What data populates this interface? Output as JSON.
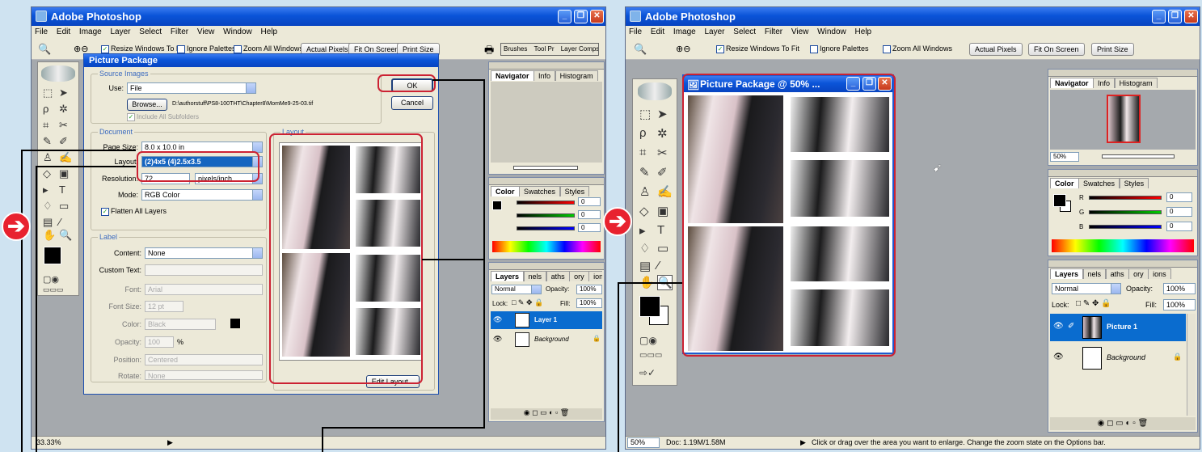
{
  "left": {
    "app_title": "Adobe Photoshop",
    "menu": [
      "File",
      "Edit",
      "Image",
      "Layer",
      "Select",
      "Filter",
      "View",
      "Window",
      "Help"
    ],
    "options": {
      "resize_windows": "Resize Windows To Fit",
      "ignore_palettes": "Ignore Palettes",
      "zoom_all": "Zoom All Windows",
      "actual_pixels": "Actual Pixels",
      "fit_on_screen": "Fit On Screen",
      "print_size": "Print Size",
      "well_tabs": [
        "Brushes",
        "Tool Pr",
        "Layer Comps"
      ]
    },
    "dialog": {
      "title": "Picture Package",
      "source_group": "Source Images",
      "use_label": "Use:",
      "use_value": "File",
      "browse_label": "Browse...",
      "file_path": "D:\\authorstuff\\PS8-100THT\\Chapter8\\MomMe9-25-03.tif",
      "include_subfolders": "Include All Subfolders",
      "document_group": "Document",
      "page_size_label": "Page Size:",
      "page_size_value": "8.0 x 10.0 in",
      "layout_label": "Layout:",
      "layout_value": "(2)4x5 (4)2.5x3.5",
      "resolution_label": "Resolution:",
      "resolution_value": "72",
      "resolution_unit": "pixels/inch",
      "mode_label": "Mode:",
      "mode_value": "RGB Color",
      "flatten_label": "Flatten All Layers",
      "label_group": "Label",
      "content_label": "Content:",
      "content_value": "None",
      "custom_text_label": "Custom Text:",
      "font_label": "Font:",
      "font_value": "Arial",
      "font_size_label": "Font Size:",
      "font_size_value": "12 pt",
      "color_label": "Color:",
      "color_value": "Black",
      "opacity_label": "Opacity:",
      "opacity_value": "100",
      "opacity_unit": "%",
      "position_label": "Position:",
      "position_value": "Centered",
      "rotate_label": "Rotate:",
      "rotate_value": "None",
      "layout_group": "Layout",
      "ok_label": "OK",
      "cancel_label": "Cancel",
      "edit_layout_label": "Edit Layout..."
    },
    "navigator_tabs": [
      "Navigator",
      "Info",
      "Histogram"
    ],
    "color_tabs": [
      "Color",
      "Swatches",
      "Styles"
    ],
    "color_values": {
      "r": "0",
      "g": "0",
      "b": "0"
    },
    "layers_tabs": [
      "Layers",
      "nels",
      "aths",
      "ory",
      "ions"
    ],
    "blend_mode": "Normal",
    "opacity_label": "Opacity:",
    "opacity_value": "100%",
    "lock_label": "Lock:",
    "fill_label": "Fill:",
    "fill_value": "100%",
    "layers": [
      "Layer 1",
      "Background"
    ],
    "zoom_status": "33.33%"
  },
  "right": {
    "app_title": "Adobe Photoshop",
    "menu": [
      "File",
      "Edit",
      "Image",
      "Layer",
      "Select",
      "Filter",
      "View",
      "Window",
      "Help"
    ],
    "options": {
      "resize_windows": "Resize Windows To Fit",
      "ignore_palettes": "Ignore Palettes",
      "zoom_all": "Zoom All Windows",
      "actual_pixels": "Actual Pixels",
      "fit_on_screen": "Fit On Screen",
      "print_size": "Print Size"
    },
    "doc_title": "Picture Package @ 50% ...",
    "navigator_tabs": [
      "Navigator",
      "Info",
      "Histogram"
    ],
    "nav_zoom": "50%",
    "color_tabs": [
      "Color",
      "Swatches",
      "Styles"
    ],
    "channel_labels": {
      "r": "R",
      "g": "G",
      "b": "B"
    },
    "color_values": {
      "r": "0",
      "g": "0",
      "b": "0"
    },
    "layers_tabs": [
      "Layers",
      "nels",
      "aths",
      "ory",
      "ions"
    ],
    "blend_mode": "Normal",
    "opacity_label": "Opacity:",
    "opacity_value": "100%",
    "lock_label": "Lock:",
    "fill_label": "Fill:",
    "fill_value": "100%",
    "layers": [
      "Picture 1",
      "Background"
    ],
    "status_zoom": "50%",
    "status_doc": "Doc: 1.19M/1.58M",
    "status_hint": "Click or drag over the area you want to enlarge. Change the zoom state on the Options bar."
  },
  "colors": {
    "callout_red": "#cc2233",
    "titlebar_blue": "#0a54d8",
    "highlight_blue": "#0a6ccf"
  }
}
